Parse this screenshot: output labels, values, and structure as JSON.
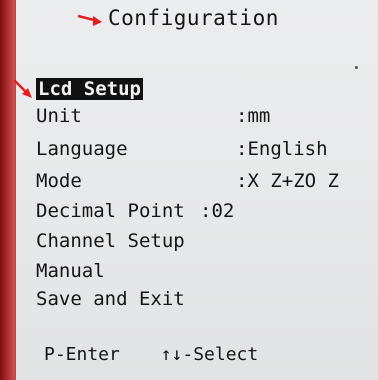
{
  "title": "Configuration",
  "menu": {
    "items": [
      {
        "label": "Lcd Setup",
        "value": ""
      },
      {
        "label": "Unit",
        "value": ":mm"
      },
      {
        "label": "Language",
        "value": ":English"
      },
      {
        "label": "Mode",
        "value": ":X Z+ZO Z"
      },
      {
        "label": "Decimal Point",
        "value": ":02"
      },
      {
        "label": "Channel Setup",
        "value": ""
      },
      {
        "label": "Manual",
        "value": ""
      },
      {
        "label": "Save and Exit",
        "value": ""
      }
    ]
  },
  "footer": {
    "enter_hint": "P-Enter",
    "select_hint": "↑↓-Select"
  },
  "colors": {
    "arrow": "#e41e1e",
    "highlight_bg": "#111111",
    "screen_bg": "#e8e9ea"
  }
}
